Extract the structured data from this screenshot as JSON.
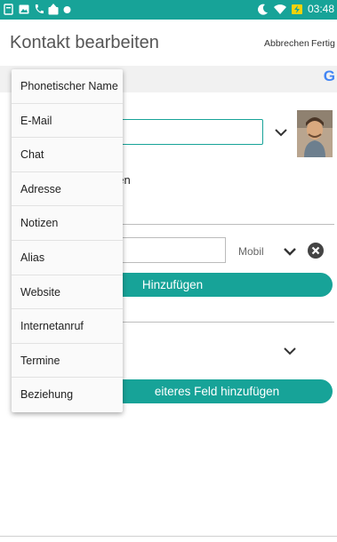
{
  "status_bar": {
    "time": "03:48",
    "left_icons": [
      "notification-icon",
      "gallery-icon",
      "phone-icon",
      "upload-icon",
      "dot-icon"
    ],
    "right_icons": [
      "moon-icon",
      "wifi-icon",
      "battery-charging-icon"
    ]
  },
  "header": {
    "title": "Kontakt bearbeiten",
    "cancel_label": "Abbrechen",
    "done_label": "Fertig"
  },
  "account": {
    "google_letter": "G"
  },
  "form": {
    "name_value": "",
    "gen_text": "gen",
    "phone_value": "",
    "phone_type": "Mobil",
    "add_phone_label": "Hinzufügen",
    "add_field_label": "eiteres Feld hinzufügen"
  },
  "menu": {
    "items": [
      "Phonetischer Name",
      "E-Mail",
      "Chat",
      "Adresse",
      "Notizen",
      "Alias",
      "Website",
      "Internetanruf",
      "Termine",
      "Beziehung"
    ]
  },
  "colors": {
    "accent": "#17a398"
  }
}
